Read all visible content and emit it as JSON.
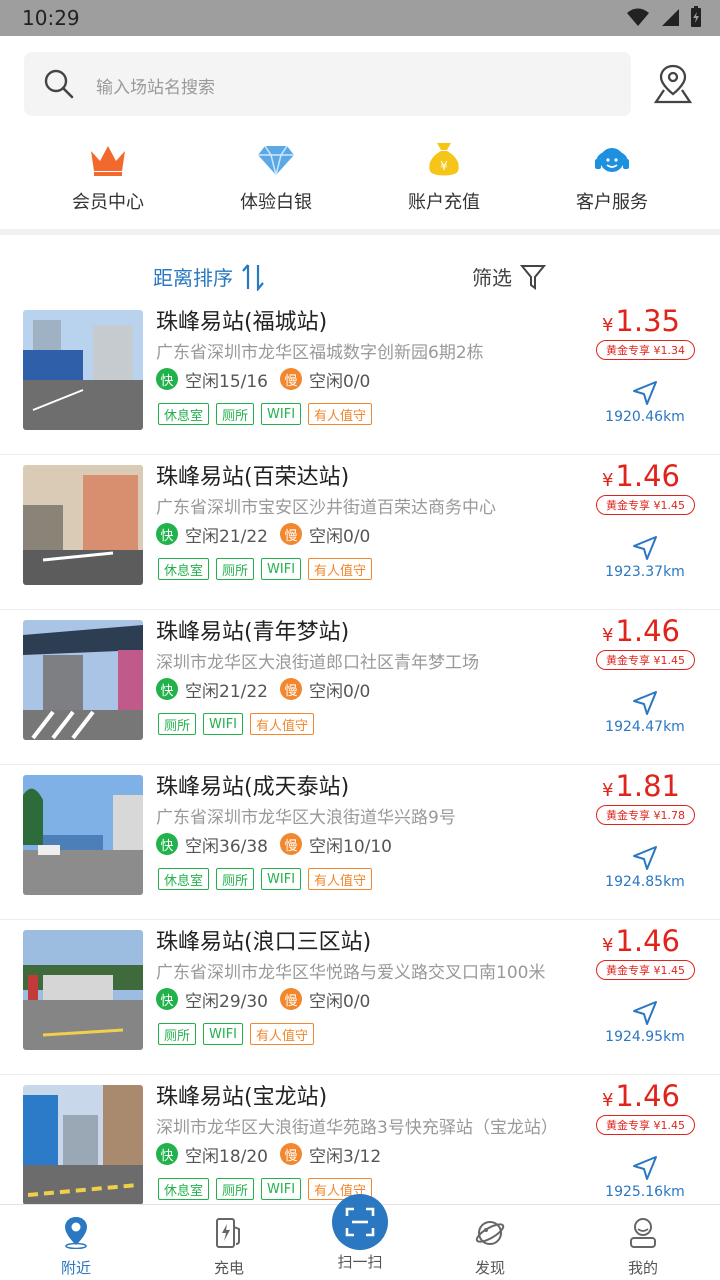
{
  "status": {
    "time": "10:29"
  },
  "search": {
    "placeholder": "输入场站名搜索"
  },
  "quick": [
    {
      "label": "会员中心",
      "icon": "crown-icon",
      "color": "#f2682d"
    },
    {
      "label": "体验白银",
      "icon": "diamond-icon",
      "color": "#5aa9e6"
    },
    {
      "label": "账户充值",
      "icon": "money-bag-icon",
      "color": "#f5c518"
    },
    {
      "label": "客户服务",
      "icon": "headset-icon",
      "color": "#1e90e0"
    }
  ],
  "sort": {
    "label": "距离排序",
    "filter": "筛选"
  },
  "stations": [
    {
      "name": "珠峰易站(福城站)",
      "address": "广东省深圳市龙华区福城数字创新园6期2栋",
      "fast_label": "快",
      "fast": "空闲15/16",
      "slow_label": "慢",
      "slow": "空闲0/0",
      "tags": [
        "休息室",
        "厕所",
        "WIFI",
        "有人值守"
      ],
      "currency": "¥",
      "price": "1.35",
      "gold": "黄金专享 ¥1.34",
      "distance": "1920.46km"
    },
    {
      "name": "珠峰易站(百荣达站)",
      "address": "广东省深圳市宝安区沙井街道百荣达商务中心",
      "fast_label": "快",
      "fast": "空闲21/22",
      "slow_label": "慢",
      "slow": "空闲0/0",
      "tags": [
        "休息室",
        "厕所",
        "WIFI",
        "有人值守"
      ],
      "currency": "¥",
      "price": "1.46",
      "gold": "黄金专享 ¥1.45",
      "distance": "1923.37km"
    },
    {
      "name": "珠峰易站(青年梦站)",
      "address": "深圳市龙华区大浪街道郎口社区青年梦工场",
      "fast_label": "快",
      "fast": "空闲21/22",
      "slow_label": "慢",
      "slow": "空闲0/0",
      "tags": [
        "厕所",
        "WIFI",
        "有人值守"
      ],
      "currency": "¥",
      "price": "1.46",
      "gold": "黄金专享 ¥1.45",
      "distance": "1924.47km"
    },
    {
      "name": "珠峰易站(成天泰站)",
      "address": "广东省深圳市龙华区大浪街道华兴路9号",
      "fast_label": "快",
      "fast": "空闲36/38",
      "slow_label": "慢",
      "slow": "空闲10/10",
      "tags": [
        "休息室",
        "厕所",
        "WIFI",
        "有人值守"
      ],
      "currency": "¥",
      "price": "1.81",
      "gold": "黄金专享 ¥1.78",
      "distance": "1924.85km"
    },
    {
      "name": "珠峰易站(浪口三区站)",
      "address": "广东省深圳市龙华区华悦路与爱义路交叉口南100米",
      "fast_label": "快",
      "fast": "空闲29/30",
      "slow_label": "慢",
      "slow": "空闲0/0",
      "tags": [
        "厕所",
        "WIFI",
        "有人值守"
      ],
      "currency": "¥",
      "price": "1.46",
      "gold": "黄金专享 ¥1.45",
      "distance": "1924.95km"
    },
    {
      "name": "珠峰易站(宝龙站)",
      "address": "深圳市龙华区大浪街道华苑路3号快充驿站（宝龙站）",
      "fast_label": "快",
      "fast": "空闲18/20",
      "slow_label": "慢",
      "slow": "空闲3/12",
      "tags": [
        "休息室",
        "厕所",
        "WIFI",
        "有人值守"
      ],
      "currency": "¥",
      "price": "1.46",
      "gold": "黄金专享 ¥1.45",
      "distance": "1925.16km"
    }
  ],
  "tabs": [
    {
      "label": "附近",
      "icon": "location-pin-icon"
    },
    {
      "label": "充电",
      "icon": "charger-icon"
    },
    {
      "label": "扫一扫",
      "icon": "scan-icon"
    },
    {
      "label": "发现",
      "icon": "planet-icon"
    },
    {
      "label": "我的",
      "icon": "user-icon"
    }
  ],
  "colors": {
    "accent": "#2a77c2",
    "price": "#e0241c",
    "fast": "#22b24c",
    "slow": "#f2872d"
  }
}
